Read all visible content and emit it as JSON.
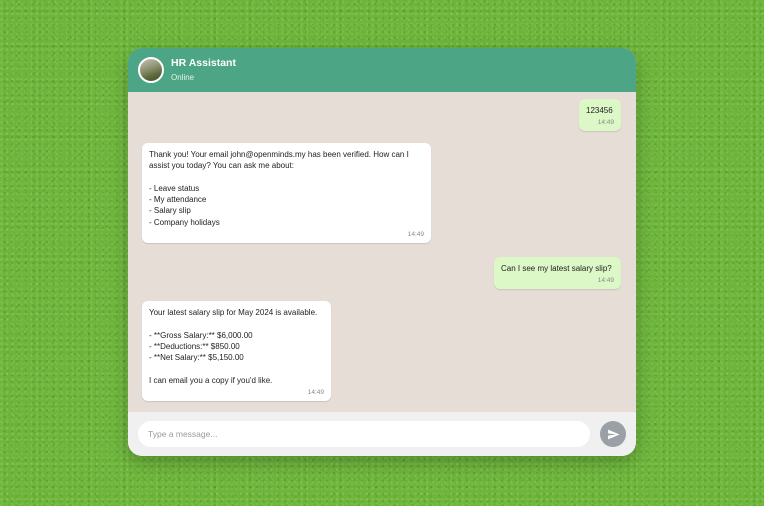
{
  "header": {
    "title": "HR Assistant",
    "status": "Online",
    "avatar_icon": "profile-photo"
  },
  "messages": [
    {
      "direction": "outgoing",
      "lines": [
        "123456"
      ],
      "time": "14:49"
    },
    {
      "direction": "incoming",
      "lines": [
        "Thank you! Your email john@openminds.my has been verified. How can I",
        "assist you today? You can ask me about:",
        "",
        "- Leave status",
        "- My attendance",
        "- Salary slip",
        "- Company holidays"
      ],
      "time": "14:49"
    },
    {
      "direction": "outgoing",
      "lines": [
        "Can I see my latest salary slip?"
      ],
      "time": "14:49"
    },
    {
      "direction": "incoming",
      "lines": [
        "Your latest salary slip for May 2024 is available.",
        "",
        "- **Gross Salary:** $6,000.00",
        "- **Deductions:** $850.00",
        "- **Net Salary:** $5,150.00",
        "",
        "I can email you a copy if you'd like."
      ],
      "time": "14:49"
    }
  ],
  "composer": {
    "placeholder": "Type a message...",
    "send_icon": "send-icon"
  },
  "colors": {
    "header": "#4ca585",
    "chat_background": "#e6ddd6",
    "outgoing_bubble": "#dcf8c6",
    "incoming_bubble": "#ffffff",
    "send_button": "#9aa0a6",
    "page_background": "#6db63a"
  }
}
